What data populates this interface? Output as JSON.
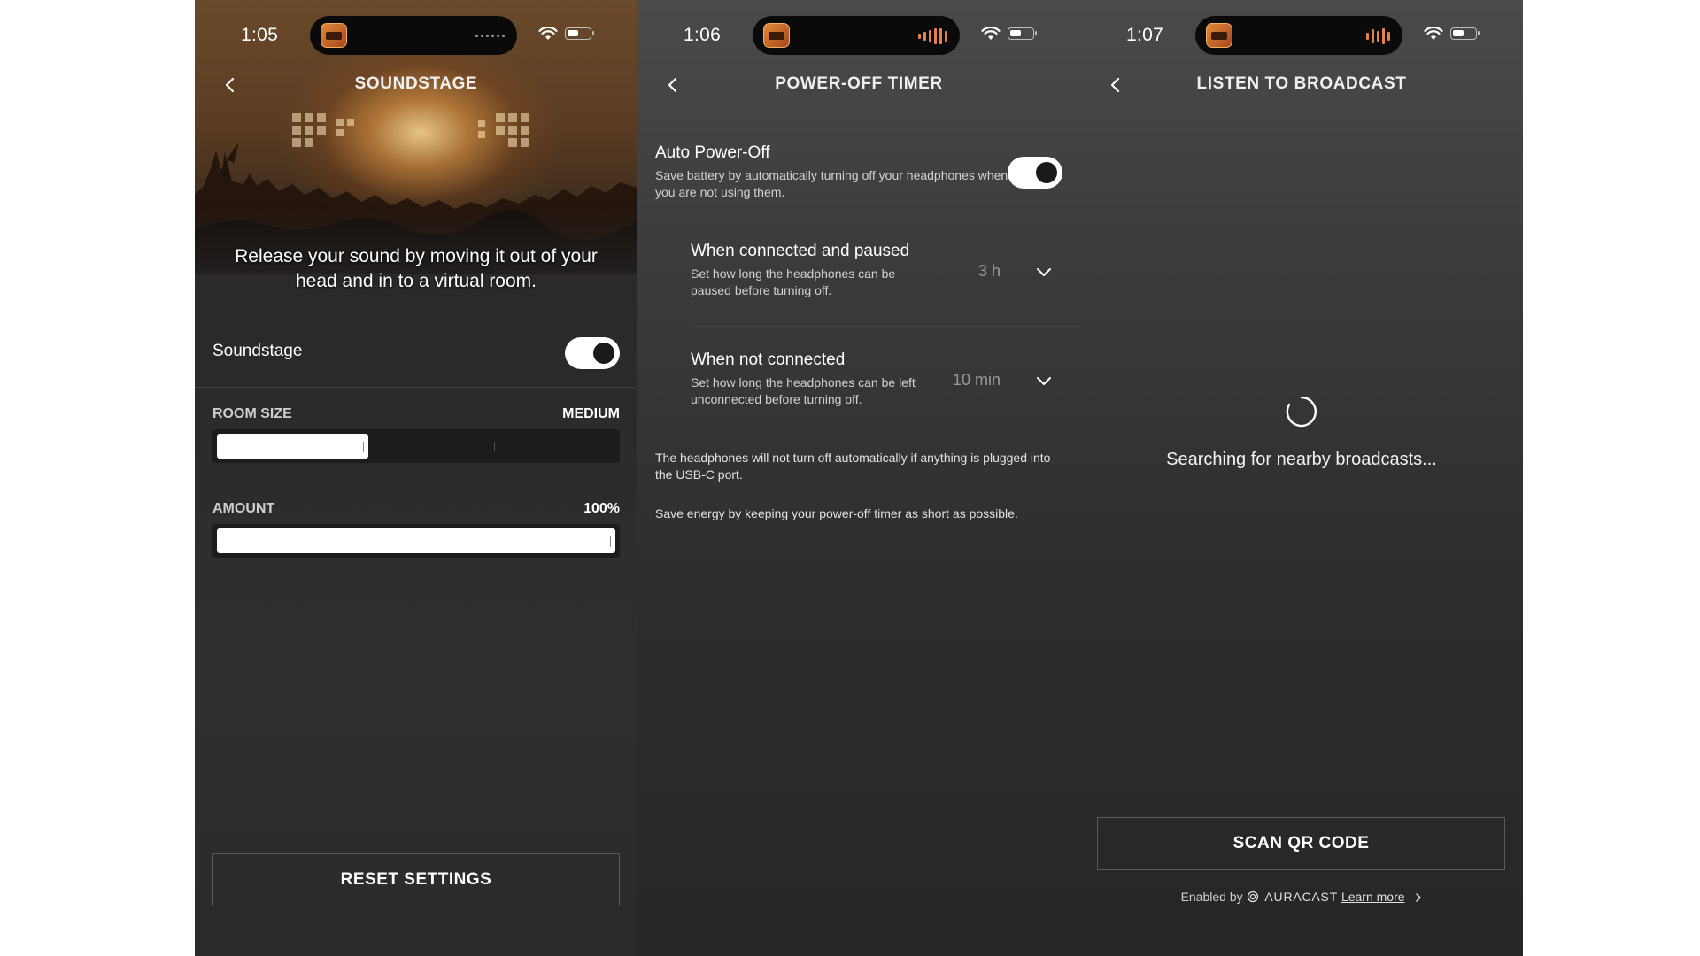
{
  "screens": [
    {
      "status_time": "1:05",
      "title": "SOUNDSTAGE",
      "hero_text": "Release your sound by moving it out of your head and in to a virtual room.",
      "soundstage_label": "Soundstage",
      "soundstage_on": true,
      "room_size_label": "ROOM SIZE",
      "room_size_value": "MEDIUM",
      "room_size_level": 0.38,
      "amount_label": "AMOUNT",
      "amount_value": "100%",
      "amount_level": 1.0,
      "reset_button": "RESET SETTINGS"
    },
    {
      "status_time": "1:06",
      "title": "POWER-OFF TIMER",
      "auto_title": "Auto Power-Off",
      "auto_desc": "Save battery by automatically turning off your headphones when you are not using them.",
      "auto_on": true,
      "paused_title": "When connected and paused",
      "paused_desc": "Set how long the headphones can be paused before turning off.",
      "paused_value": "3 h",
      "not_connected_title": "When not connected",
      "not_connected_desc": "Set how long the headphones can be left unconnected before turning off.",
      "not_connected_value": "10 min",
      "note_1": "The headphones will not turn off automatically if anything is plugged into the USB-C port.",
      "note_2": "Save energy by keeping your power-off timer as short as possible."
    },
    {
      "status_time": "1:07",
      "title": "LISTEN TO BROADCAST",
      "searching_text": "Searching for nearby broadcasts...",
      "scan_button": "SCAN QR CODE",
      "enabled_by": "Enabled by",
      "brand": "AURACAST",
      "learn_more": "Learn more"
    }
  ],
  "colors": {
    "accent_orange": "#e2834a",
    "toggle_on": "#ffffff",
    "knob": "#1a1a1a",
    "divider": "#3f3f42"
  },
  "icons": [
    "back-chevron-icon",
    "wifi-icon",
    "battery-icon",
    "chevron-down-icon",
    "spinner-icon",
    "auracast-icon",
    "chevron-right-icon"
  ]
}
